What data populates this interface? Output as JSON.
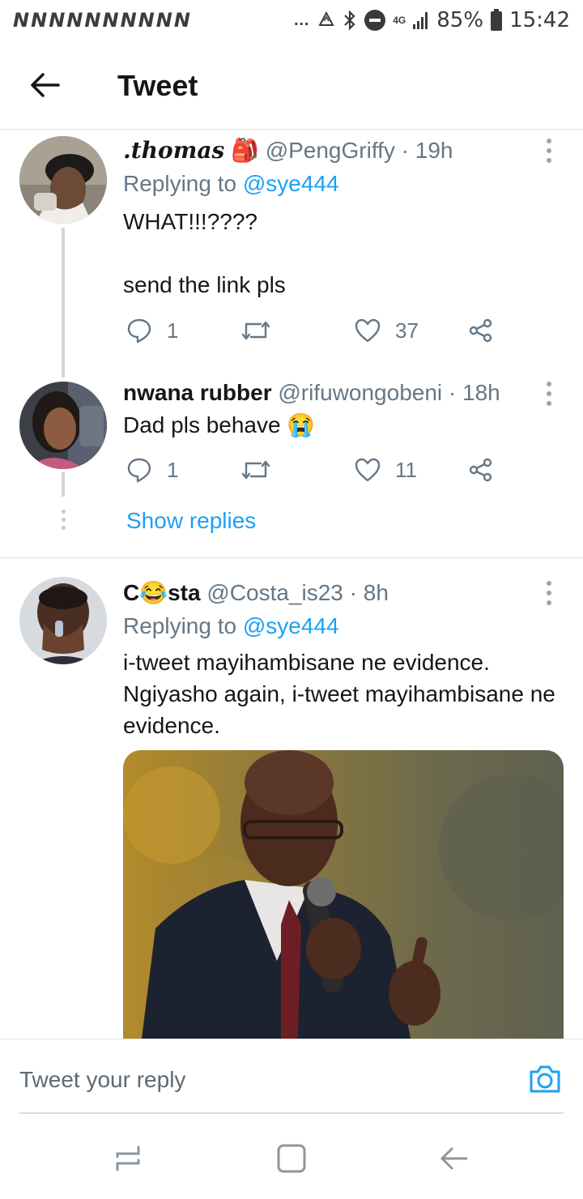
{
  "status_bar": {
    "notification_icons": [
      "N",
      "N",
      "N",
      "N",
      "N",
      "N",
      "N",
      "N",
      "N",
      "N"
    ],
    "more": "…",
    "network": "4G",
    "battery": "85%",
    "time": "15:42"
  },
  "header": {
    "title": "Tweet"
  },
  "tweets": [
    {
      "display_name": ".thomas",
      "name_emoji": "🎒",
      "handle": "@PengGriffy",
      "time": "· 19h",
      "replying_prefix": "Replying to",
      "replying_to": "@sye444",
      "text": "WHAT!!!????\n\nsend the link pls",
      "replies": "1",
      "likes": "37"
    },
    {
      "display_name": "nwana rubber",
      "handle": "@rifuwongobeni",
      "time": "· 18h",
      "text": "Dad pls behave 😭",
      "replies": "1",
      "likes": "11",
      "show_replies": "Show replies"
    },
    {
      "display_name_pre": "C",
      "display_name_emoji": "😂",
      "display_name_post": "sta",
      "handle": "@Costa_is23",
      "time": "· 8h",
      "replying_prefix": "Replying to",
      "replying_to": "@sye444",
      "text": "i-tweet mayihambisane ne evidence.\nNgiyasho again, i-tweet mayihambisane ne evidence."
    }
  ],
  "reply_bar": {
    "placeholder": "Tweet your reply"
  },
  "colors": {
    "accent": "#1da1f2",
    "secondary_text": "#657786",
    "primary_text": "#14171a",
    "divider": "#dfe3e6"
  }
}
